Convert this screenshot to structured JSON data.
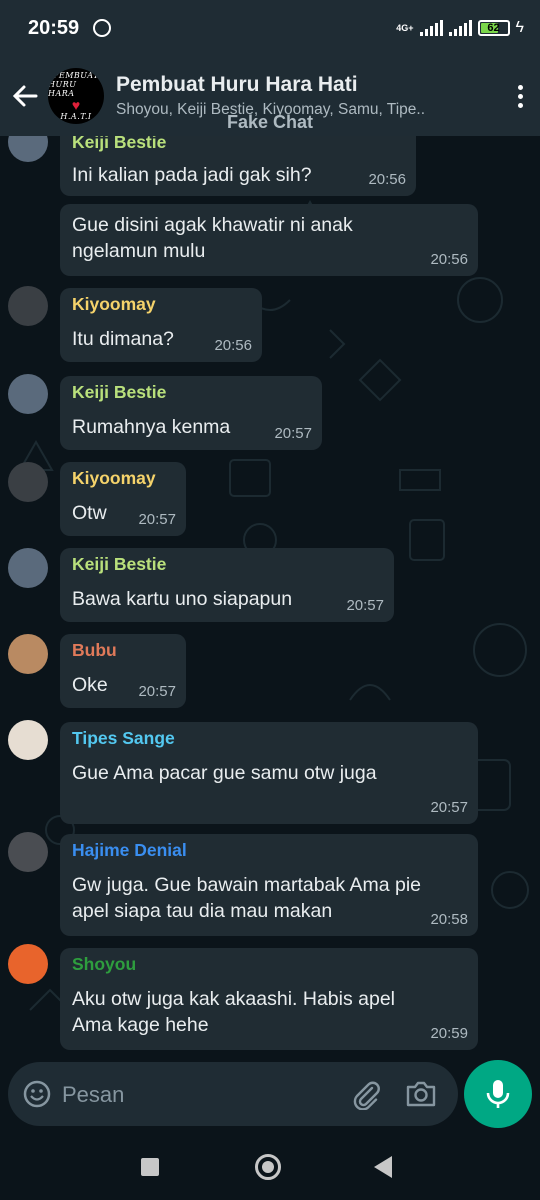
{
  "status_bar": {
    "time": "20:59",
    "network": "4G+",
    "battery": "62",
    "battery_level": 0.62
  },
  "header": {
    "title": "Pembuat Huru Hara Hati",
    "subtitle": "Shoyou, Keiji Bestie, Kiyoomay, Samu, Tipe..",
    "avatar_lines": [
      "PEMBUAT",
      "HURU HARA",
      "H.A.T.I"
    ],
    "watermark": "Fake Chat"
  },
  "messages": [
    {
      "sender": "Keiji Bestie",
      "sender_color": "#b9e07c",
      "lines": [
        "Ini kalian pada jadi gak sih?"
      ],
      "time": "20:56"
    },
    {
      "sender": "",
      "sender_color": "",
      "lines": [
        "Gue disini agak khawatir ni anak",
        "ngelamun mulu"
      ],
      "time": "20:56"
    },
    {
      "sender": "Kiyoomay",
      "sender_color": "#f5d36b",
      "lines": [
        "Itu dimana?"
      ],
      "time": "20:56"
    },
    {
      "sender": "Keiji Bestie",
      "sender_color": "#b9e07c",
      "lines": [
        "Rumahnya kenma"
      ],
      "time": "20:57"
    },
    {
      "sender": "Kiyoomay",
      "sender_color": "#f5d36b",
      "lines": [
        "Otw"
      ],
      "time": "20:57"
    },
    {
      "sender": "Keiji Bestie",
      "sender_color": "#b9e07c",
      "lines": [
        "Bawa kartu uno siapapun"
      ],
      "time": "20:57"
    },
    {
      "sender": "Bubu",
      "sender_color": "#e07a5a",
      "lines": [
        "Oke"
      ],
      "time": "20:57"
    },
    {
      "sender": "Tipes Sange",
      "sender_color": "#53c8f0",
      "lines": [
        "Gue Ama pacar gue samu otw juga"
      ],
      "time": "20:57"
    },
    {
      "sender": "Hajime Denial",
      "sender_color": "#3a8ef0",
      "lines": [
        "Gw juga. Gue bawain martabak Ama pie",
        "apel siapa tau dia mau makan"
      ],
      "time": "20:58"
    },
    {
      "sender": "Shoyou",
      "sender_color": "#2e9e3e",
      "lines": [
        "Aku otw juga kak akaashi. Habis apel",
        "Ama kage hehe"
      ],
      "time": "20:59"
    }
  ],
  "composer": {
    "placeholder": "Pesan"
  },
  "icons": {
    "back": "arrow-left-icon",
    "menu": "more-vertical-icon",
    "emoji": "emoji-icon",
    "attach": "paperclip-icon",
    "camera": "camera-icon",
    "mic": "mic-icon"
  },
  "colors": {
    "background": "#0b141a",
    "bar": "#1f2c34",
    "bubble": "#202c33",
    "accent": "#00a884"
  }
}
